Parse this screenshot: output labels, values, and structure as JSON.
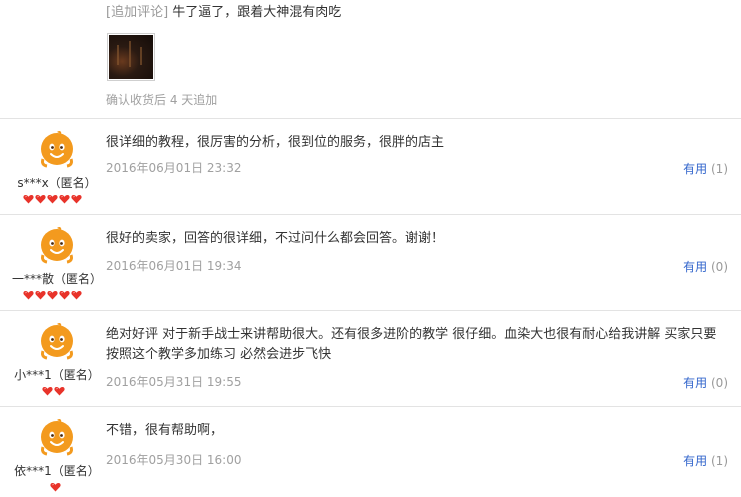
{
  "followup": {
    "tag": "[追加评论]",
    "text": "牛了逼了，跟着大神混有肉吃",
    "image_icon": "photo-thumbnail",
    "date_text": "确认收货后 4 天追加"
  },
  "reviews": [
    {
      "user": "s***x（匿名）",
      "hearts": 5,
      "content": "很详细的教程，很厉害的分析，很到位的服务，很胖的店主",
      "date": "2016年06月01日 23:32",
      "useful_label": "有用",
      "useful_count": "(1)"
    },
    {
      "user": "一***散（匿名）",
      "hearts": 5,
      "content": "很好的卖家，回答的很详细，不过问什么都会回答。谢谢！",
      "date": "2016年06月01日 19:34",
      "useful_label": "有用",
      "useful_count": "(0)"
    },
    {
      "user": "小***1（匿名）",
      "hearts": 2,
      "content": "绝对好评 对于新手战士来讲帮助很大。还有很多进阶的教学 很仔细。血染大也很有耐心给我讲解 买家只要按照这个教学多加练习 必然会进步飞快",
      "date": "2016年05月31日 19:55",
      "useful_label": "有用",
      "useful_count": "(0)"
    },
    {
      "user": "依***1（匿名）",
      "hearts": 1,
      "content": "不错，很有帮助啊，",
      "date": "2016年05月30日 16:00",
      "useful_label": "有用",
      "useful_count": "(1)"
    }
  ],
  "colors": {
    "avatar_orange": "#f39a1e",
    "heart_red": "#e8332a",
    "link_blue": "#3366cc",
    "muted_gray": "#a0a0a0"
  }
}
